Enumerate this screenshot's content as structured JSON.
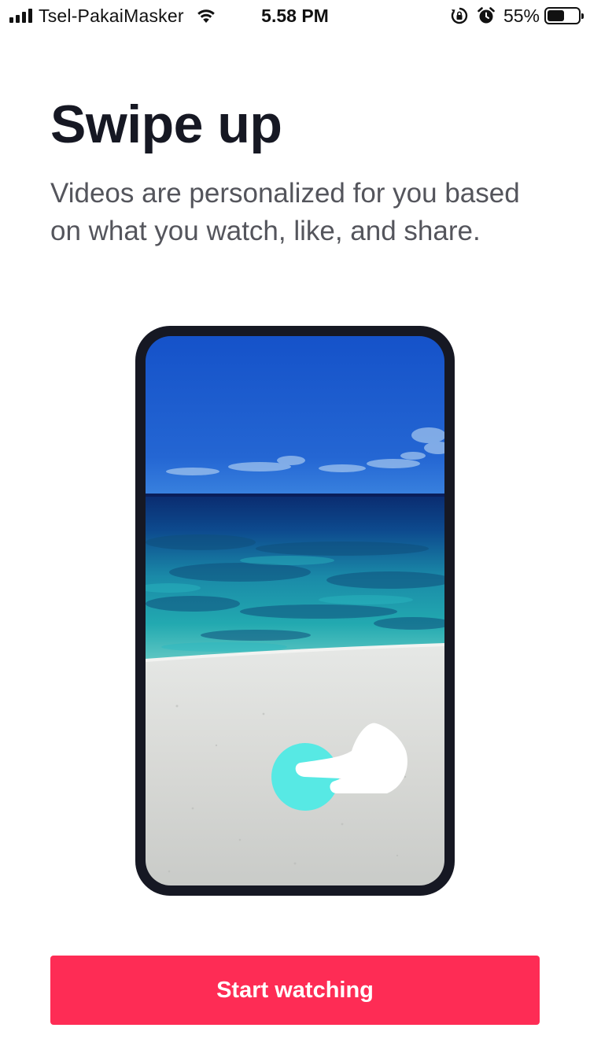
{
  "status_bar": {
    "carrier": "Tsel-PakaiMasker",
    "time": "5.58 PM",
    "battery_percent": "55%",
    "battery_level": 0.55,
    "icons": [
      "signal-icon",
      "wifi-icon",
      "rotation-lock-icon",
      "alarm-icon",
      "battery-icon"
    ]
  },
  "onboarding": {
    "title": "Swipe up",
    "description": "Videos are personalized for you based on what you watch, like, and share.",
    "illustration": {
      "icons": [
        "phone-illustration",
        "swipe-hand-icon",
        "touch-point-icon"
      ],
      "touch_color": "#57e9e4"
    }
  },
  "actions": {
    "start_label": "Start watching"
  },
  "colors": {
    "accent": "#fe2c55",
    "title": "#161823",
    "body_text": "#54555c",
    "phone_frame": "#161823"
  }
}
